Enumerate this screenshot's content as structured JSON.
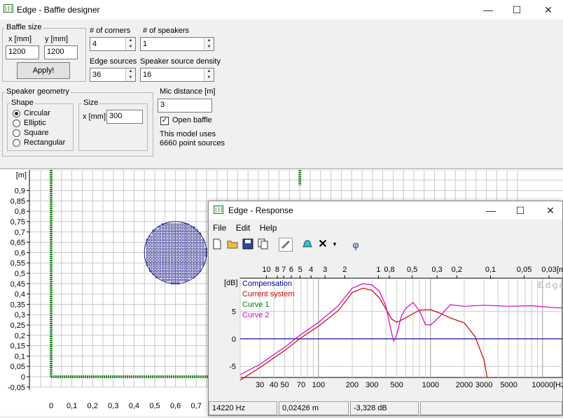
{
  "window": {
    "title": "Edge - Baffle designer",
    "icon_text": "|||"
  },
  "controls": {
    "baffle_size": {
      "label": "Baffle size",
      "x_label": "x [mm]",
      "y_label": "y [mm]",
      "x_value": "1200",
      "y_value": "1200",
      "apply_label": "Apply!"
    },
    "corners": {
      "label": "# of corners",
      "value": "4"
    },
    "speakers": {
      "label": "# of speakers",
      "value": "1"
    },
    "edge_sources": {
      "label": "Edge sources",
      "value": "36"
    },
    "density": {
      "label": "Speaker source density",
      "value": "16"
    },
    "speaker_geometry": {
      "label": "Speaker geometry",
      "shape_label": "Shape",
      "shapes": [
        "Circular",
        "Elliptic",
        "Square",
        "Rectangular"
      ],
      "selected": "Circular",
      "size_label": "Size",
      "size_x_label": "x [mm]",
      "size_value": "300"
    },
    "mic": {
      "label": "Mic distance [m]",
      "value": "3",
      "open_baffle_label": "Open baffle",
      "open_baffle_checked": true
    },
    "model_info": [
      "This model uses",
      "6660 point sources"
    ]
  },
  "baffle_plot": {
    "y_unit": "[m]",
    "y_ticks": [
      "0,9",
      "0,85",
      "0,8",
      "0,75",
      "0,7",
      "0,65",
      "0,6",
      "0,55",
      "0,5",
      "0,45",
      "0,4",
      "0,35",
      "0,3",
      "0,25",
      "0,2",
      "0,15",
      "0,1",
      "0,05",
      "0",
      "-0,05"
    ],
    "x_ticks": [
      "0",
      "0,1",
      "0,2",
      "0,3",
      "0,4",
      "0,5",
      "0,6",
      "0,7"
    ],
    "speaker_center_m": [
      0.6,
      0.6
    ],
    "speaker_diameter_m": 0.3,
    "colors": {
      "baffle": "#2a8a2a",
      "speaker": "#1a1a8a",
      "grid": "#c8c8c8"
    }
  },
  "response_window": {
    "title": "Edge - Response",
    "menu": [
      "File",
      "Edit",
      "Help"
    ],
    "toolbar": [
      "new-icon",
      "open-icon",
      "save-icon",
      "copy-icon",
      "pen-icon",
      "bell-icon",
      "close-x-icon",
      "dropdown-icon",
      "phi-icon"
    ],
    "phi_label": "φ",
    "status": [
      "14220 Hz",
      "0,02426 m",
      "-3,328 dB"
    ]
  },
  "chart_data": {
    "type": "line",
    "xscale": "log",
    "xlabel": "[Hz]",
    "ylabel": "[dB]",
    "x_tick_labels": [
      "30",
      "40",
      "50",
      "70",
      "100",
      "200",
      "300",
      "500",
      "1000",
      "2000",
      "3000",
      "5000",
      "10000"
    ],
    "top_tick_labels": [
      "10",
      "8",
      "7",
      "6",
      "5",
      "4",
      "3",
      "2",
      "1",
      "0,8",
      "0,5",
      "0,3",
      "0,2",
      "0,1",
      "0,05",
      "0,03",
      "[m"
    ],
    "y_tick_labels": [
      "5",
      "0",
      "-5"
    ],
    "watermark": "Edge",
    "xlim": [
      20,
      15000
    ],
    "ylim": [
      -7,
      11
    ],
    "legend": [
      "Compensation",
      "Current system",
      "Curve 1",
      "Curve 2"
    ],
    "legend_colors": [
      "#0000a0",
      "#c80000",
      "#008000",
      "#d000d0"
    ],
    "series": [
      {
        "name": "Compensation",
        "color": "#0000a0",
        "x": [
          20,
          15000
        ],
        "y": [
          0,
          0
        ]
      },
      {
        "name": "Current system",
        "color": "#c80000",
        "x": [
          20,
          30,
          50,
          70,
          100,
          150,
          200,
          250,
          300,
          350,
          400,
          450,
          500,
          600,
          700,
          800,
          1000,
          1200,
          1500,
          2000,
          2500,
          3000,
          3200
        ],
        "y": [
          -7.5,
          -5.2,
          -2.1,
          0.2,
          2.3,
          5.1,
          8.4,
          9.2,
          8.8,
          7.4,
          5.4,
          3.6,
          3.0,
          3.8,
          4.6,
          5.2,
          5.3,
          4.7,
          3.8,
          2.9,
          0.4,
          -3.8,
          -7
        ]
      },
      {
        "name": "Curve 2",
        "color": "#d000d0",
        "x": [
          20,
          30,
          50,
          70,
          100,
          150,
          200,
          250,
          300,
          350,
          400,
          450,
          470,
          500,
          550,
          600,
          700,
          800,
          900,
          1000,
          1200,
          1500,
          2000,
          3000,
          5000,
          8000,
          12000,
          15000
        ],
        "y": [
          -6.5,
          -4.6,
          -1.5,
          0.8,
          3.0,
          6.0,
          9.2,
          10.0,
          9.8,
          8.6,
          5.9,
          1.0,
          -0.4,
          0.8,
          4.2,
          5.5,
          6.6,
          5.0,
          2.6,
          2.5,
          4.0,
          6.2,
          5.9,
          6.1,
          5.9,
          6.0,
          5.7,
          5.6
        ]
      }
    ]
  }
}
